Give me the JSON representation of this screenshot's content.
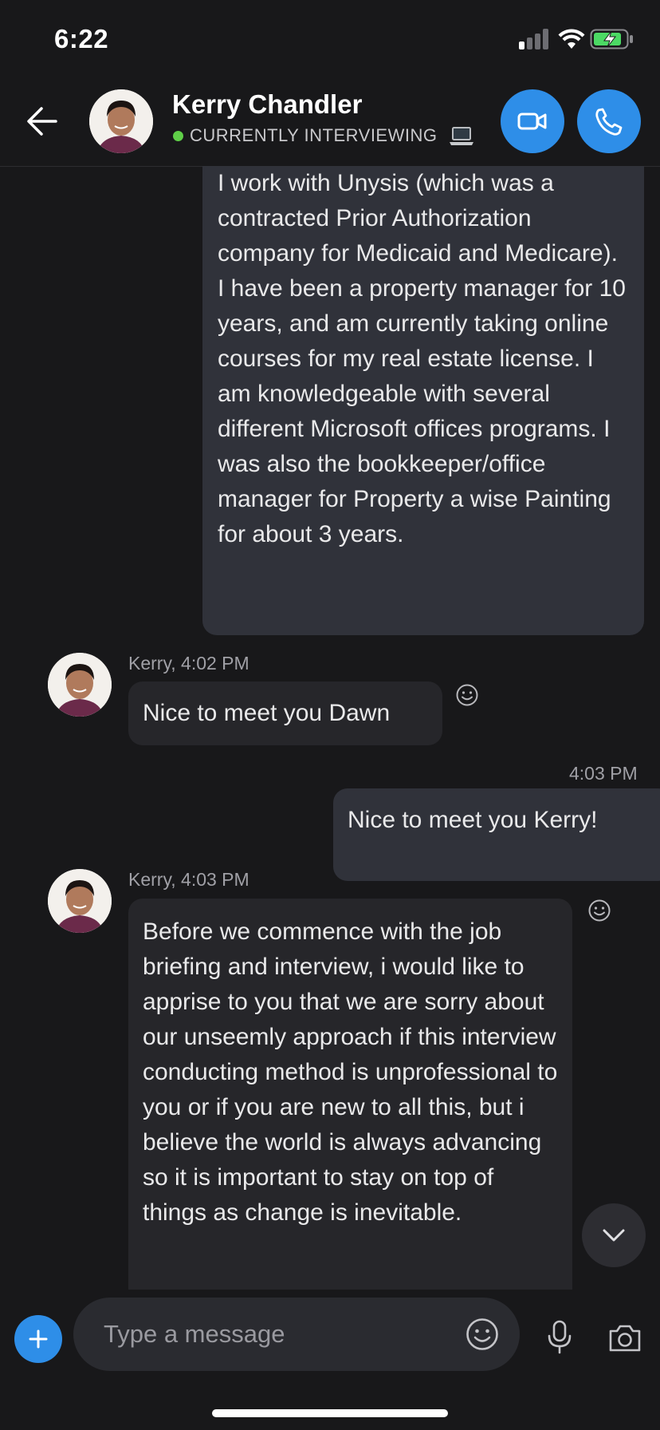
{
  "status_bar": {
    "time": "6:22"
  },
  "header": {
    "contact_name": "Kerry Chandler",
    "status": "CURRENTLY INTERVIEWING",
    "status_color": "#5fcf48",
    "accent_color": "#2e8ee8"
  },
  "messages": [
    {
      "direction": "outgoing",
      "text": "I work with Unysis (which was a contracted Prior Authorization company for Medicaid and Medicare). I have been a property manager for 10 years, and am currently taking online courses for my real estate license. I am knowledgeable with several different Microsoft offices programs. I was also the bookkeeper/office manager for Property a wise Painting for about 3 years."
    },
    {
      "direction": "incoming",
      "meta": "Kerry, 4:02 PM",
      "text": "Nice to meet you Dawn"
    },
    {
      "direction": "outgoing",
      "meta": "4:03 PM",
      "text": "Nice to meet you Kerry!"
    },
    {
      "direction": "incoming",
      "meta": "Kerry, 4:03 PM",
      "text": "Before we commence with the job briefing and interview, i would like to apprise to you that we are sorry about our unseemly approach if this interview conducting method is unprofessional to you or if you are new to all this, but i believe the world is always advancing so it is important to stay on top of things as change is inevitable."
    }
  ],
  "composer": {
    "placeholder": "Type a message"
  },
  "icons": {
    "back": "back-arrow-icon",
    "video": "video-camera-icon",
    "call": "phone-icon",
    "react": "smiley-icon",
    "scroll": "chevron-down-icon",
    "add": "plus-icon",
    "emoji": "emoji-icon",
    "mic": "microphone-icon",
    "camera": "camera-icon"
  }
}
